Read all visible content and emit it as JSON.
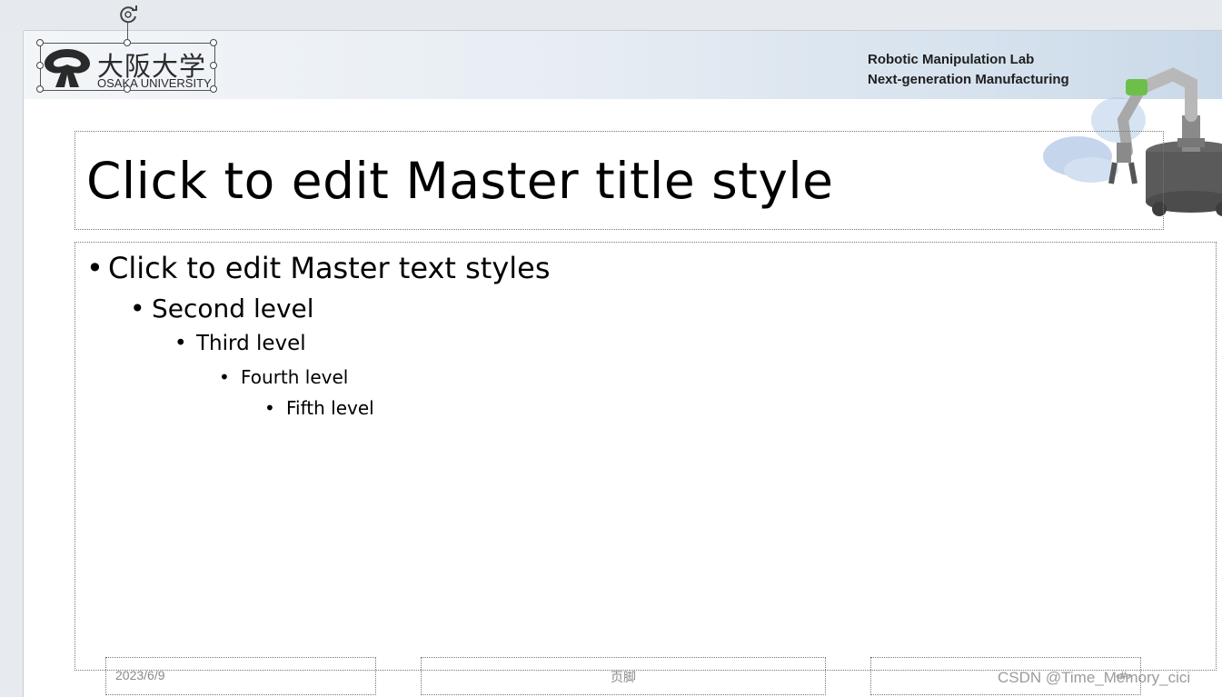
{
  "header": {
    "lab_name": "Robotic Manipulation Lab",
    "lab_subtitle": "Next-generation Manufacturing"
  },
  "logo": {
    "kanji": "大阪大学",
    "english": "OSAKA UNIVERSITY"
  },
  "title_placeholder": {
    "text": "Click to edit Master title style"
  },
  "body_placeholder": {
    "levels": [
      "Click to edit Master text styles",
      "Second level",
      "Third level",
      "Fourth level",
      "Fifth level"
    ]
  },
  "footer": {
    "date": "2023/6/9",
    "footer_text": "页脚",
    "slide_number": "‹#›"
  },
  "watermark": "CSDN @Time_Memory_cici",
  "icons": {
    "rotate": "rotate-handle-icon",
    "logo": "osaka-university-emblem-icon",
    "robot": "robot-arm-illustration"
  },
  "colors": {
    "header_band_left": "#f3f6f9",
    "header_band_right": "#cad9e8",
    "robot_green": "#6cc04a"
  }
}
